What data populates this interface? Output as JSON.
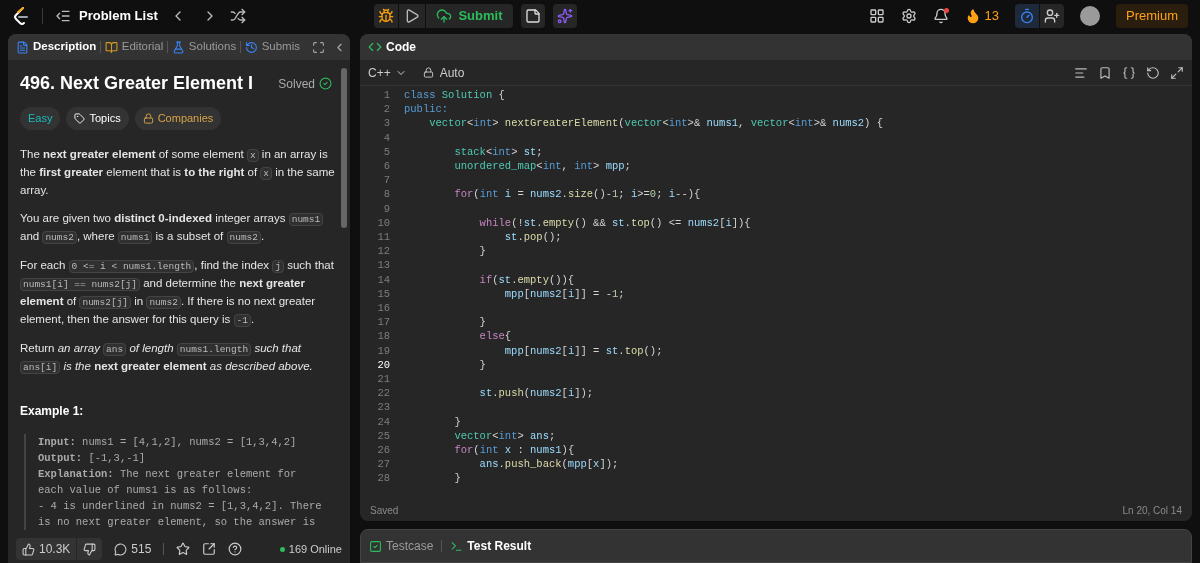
{
  "top_bar": {
    "problem_list": "Problem List",
    "submit": "Submit",
    "streak": "13",
    "premium": "Premium"
  },
  "description_panel": {
    "tabs": [
      {
        "label": "Description",
        "selected": true
      },
      {
        "label": "Editorial",
        "selected": false
      },
      {
        "label": "Solutions",
        "selected": false
      },
      {
        "label": "Submis",
        "selected": false
      }
    ],
    "title": "496. Next Greater Element I",
    "status": "Solved",
    "tags": [
      {
        "label": "Easy",
        "kind": "difficulty"
      },
      {
        "label": "Topics",
        "kind": "topics"
      },
      {
        "label": "Companies",
        "kind": "companies"
      }
    ],
    "paragraphs": [
      [
        {
          "kind": "text",
          "text": "The **next greater element** of some element "
        },
        {
          "kind": "code",
          "text": "x"
        },
        {
          "kind": "text",
          "text": " in an array is the **first greater** element that is **to the right** of "
        },
        {
          "kind": "code",
          "text": "x"
        },
        {
          "kind": "text",
          "text": " in the same array."
        }
      ],
      [
        {
          "kind": "text",
          "text": "You are given two **distinct 0-indexed** integer arrays "
        },
        {
          "kind": "code",
          "text": "nums1"
        },
        {
          "kind": "text",
          "text": " and "
        },
        {
          "kind": "code",
          "text": "nums2"
        },
        {
          "kind": "text",
          "text": ", where "
        },
        {
          "kind": "code",
          "text": "nums1"
        },
        {
          "kind": "text",
          "text": " is a subset of "
        },
        {
          "kind": "code",
          "text": "nums2"
        },
        {
          "kind": "text",
          "text": "."
        }
      ],
      [
        {
          "kind": "text",
          "text": "For each "
        },
        {
          "kind": "code",
          "text": "0 <= i < nums1.length"
        },
        {
          "kind": "text",
          "text": ", find the index "
        },
        {
          "kind": "code",
          "text": "j"
        },
        {
          "kind": "text",
          "text": " such that "
        },
        {
          "kind": "code",
          "text": "nums1[i] == nums2[j]"
        },
        {
          "kind": "text",
          "text": " and determine the **next greater element** of "
        },
        {
          "kind": "code",
          "text": "nums2[j]"
        },
        {
          "kind": "text",
          "text": " in "
        },
        {
          "kind": "code",
          "text": "nums2"
        },
        {
          "kind": "text",
          "text": ". If there is no next greater element, then the answer for this query is "
        },
        {
          "kind": "code",
          "text": "-1"
        },
        {
          "kind": "text",
          "text": "."
        }
      ],
      [
        {
          "kind": "text",
          "text": "Return *an array* "
        },
        {
          "kind": "code",
          "text": "ans"
        },
        {
          "kind": "text",
          "text": " *of length* "
        },
        {
          "kind": "code",
          "text": "nums1.length"
        },
        {
          "kind": "text",
          "text": " *such that* "
        },
        {
          "kind": "code",
          "text": "ans[i]"
        },
        {
          "kind": "text",
          "text": " *is the* **next greater element** *as described above.*"
        }
      ]
    ],
    "example_title": "Example 1:",
    "example_lines": [
      "**Input:** nums1 = [4,1,2], nums2 = [1,3,4,2]",
      "**Output:** [-1,3,-1]",
      "**Explanation:** The next greater element for",
      "each value of nums1 is as follows:",
      "- 4 is underlined in nums2 = [1,3,4,2]. There",
      "is no next greater element, so the answer is"
    ],
    "likes": "10.3K",
    "comments": "515",
    "online": "169 Online"
  },
  "code_panel": {
    "title": "Code",
    "language": "C++",
    "mode": "Auto",
    "status": "Saved",
    "cursor": "Ln 20, Col 14",
    "lines": [
      {
        "n": "1",
        "active": false,
        "tokens": [
          {
            "kind": "k",
            "text": "class "
          },
          {
            "kind": "t",
            "text": "Solution "
          },
          {
            "kind": "p",
            "text": "{"
          }
        ]
      },
      {
        "n": "2",
        "active": false,
        "tokens": [
          {
            "kind": "k",
            "text": "public:"
          }
        ]
      },
      {
        "n": "3",
        "active": false,
        "tokens": [
          {
            "kind": "t",
            "text": "    vector"
          },
          {
            "kind": "p",
            "text": "<"
          },
          {
            "kind": "k",
            "text": "int"
          },
          {
            "kind": "p",
            "text": "> "
          },
          {
            "kind": "f",
            "text": "nextGreaterElement"
          },
          {
            "kind": "p",
            "text": "("
          },
          {
            "kind": "t",
            "text": "vector"
          },
          {
            "kind": "p",
            "text": "<"
          },
          {
            "kind": "k",
            "text": "int"
          },
          {
            "kind": "p",
            "text": ">& "
          },
          {
            "kind": "v",
            "text": "nums1"
          },
          {
            "kind": "p",
            "text": ", "
          },
          {
            "kind": "t",
            "text": "vector"
          },
          {
            "kind": "p",
            "text": "<"
          },
          {
            "kind": "k",
            "text": "int"
          },
          {
            "kind": "p",
            "text": ">& "
          },
          {
            "kind": "v",
            "text": "nums2"
          },
          {
            "kind": "p",
            "text": ") {"
          }
        ]
      },
      {
        "n": "4",
        "active": false
      },
      {
        "n": "5",
        "active": false,
        "tokens": [
          {
            "kind": "t",
            "text": "        stack"
          },
          {
            "kind": "p",
            "text": "<"
          },
          {
            "kind": "k",
            "text": "int"
          },
          {
            "kind": "p",
            "text": "> "
          },
          {
            "kind": "v",
            "text": "st"
          },
          {
            "kind": "p",
            "text": ";"
          }
        ]
      },
      {
        "n": "6",
        "active": false,
        "tokens": [
          {
            "kind": "t",
            "text": "        unordered_map"
          },
          {
            "kind": "p",
            "text": "<"
          },
          {
            "kind": "k",
            "text": "int"
          },
          {
            "kind": "p",
            "text": ", "
          },
          {
            "kind": "k",
            "text": "int"
          },
          {
            "kind": "p",
            "text": "> "
          },
          {
            "kind": "v",
            "text": "mpp"
          },
          {
            "kind": "p",
            "text": ";"
          }
        ]
      },
      {
        "n": "7",
        "active": false
      },
      {
        "n": "8",
        "active": false,
        "tokens": [
          {
            "kind": "c",
            "text": "        for"
          },
          {
            "kind": "p",
            "text": "("
          },
          {
            "kind": "k",
            "text": "int "
          },
          {
            "kind": "v",
            "text": "i"
          },
          {
            "kind": "p",
            "text": " = "
          },
          {
            "kind": "v",
            "text": "nums2"
          },
          {
            "kind": "p",
            "text": "."
          },
          {
            "kind": "f",
            "text": "size"
          },
          {
            "kind": "p",
            "text": "()-"
          },
          {
            "kind": "n",
            "text": "1"
          },
          {
            "kind": "p",
            "text": "; "
          },
          {
            "kind": "v",
            "text": "i"
          },
          {
            "kind": "p",
            "text": ">="
          },
          {
            "kind": "n",
            "text": "0"
          },
          {
            "kind": "p",
            "text": "; "
          },
          {
            "kind": "v",
            "text": "i"
          },
          {
            "kind": "p",
            "text": "--){"
          }
        ]
      },
      {
        "n": "9",
        "active": false
      },
      {
        "n": "10",
        "active": false,
        "tokens": [
          {
            "kind": "c",
            "text": "            while"
          },
          {
            "kind": "p",
            "text": "(!"
          },
          {
            "kind": "v",
            "text": "st"
          },
          {
            "kind": "p",
            "text": "."
          },
          {
            "kind": "f",
            "text": "empty"
          },
          {
            "kind": "p",
            "text": "() && "
          },
          {
            "kind": "v",
            "text": "st"
          },
          {
            "kind": "p",
            "text": "."
          },
          {
            "kind": "f",
            "text": "top"
          },
          {
            "kind": "p",
            "text": "() <= "
          },
          {
            "kind": "v",
            "text": "nums2"
          },
          {
            "kind": "p",
            "text": "["
          },
          {
            "kind": "v",
            "text": "i"
          },
          {
            "kind": "p",
            "text": "]){"
          }
        ]
      },
      {
        "n": "11",
        "active": false,
        "tokens": [
          {
            "kind": "v",
            "text": "                st"
          },
          {
            "kind": "p",
            "text": "."
          },
          {
            "kind": "f",
            "text": "pop"
          },
          {
            "kind": "p",
            "text": "();"
          }
        ]
      },
      {
        "n": "12",
        "active": false,
        "tokens": [
          {
            "kind": "p",
            "text": "            }"
          }
        ]
      },
      {
        "n": "13",
        "active": false
      },
      {
        "n": "14",
        "active": false,
        "tokens": [
          {
            "kind": "c",
            "text": "            if"
          },
          {
            "kind": "p",
            "text": "("
          },
          {
            "kind": "v",
            "text": "st"
          },
          {
            "kind": "p",
            "text": "."
          },
          {
            "kind": "f",
            "text": "empty"
          },
          {
            "kind": "p",
            "text": "()){"
          }
        ]
      },
      {
        "n": "15",
        "active": false,
        "tokens": [
          {
            "kind": "v",
            "text": "                mpp"
          },
          {
            "kind": "p",
            "text": "["
          },
          {
            "kind": "v",
            "text": "nums2"
          },
          {
            "kind": "p",
            "text": "["
          },
          {
            "kind": "v",
            "text": "i"
          },
          {
            "kind": "p",
            "text": "]] = -"
          },
          {
            "kind": "n",
            "text": "1"
          },
          {
            "kind": "p",
            "text": ";"
          }
        ]
      },
      {
        "n": "16",
        "active": false
      },
      {
        "n": "17",
        "active": false,
        "tokens": [
          {
            "kind": "p",
            "text": "            }"
          }
        ]
      },
      {
        "n": "18",
        "active": false,
        "tokens": [
          {
            "kind": "c",
            "text": "            else"
          },
          {
            "kind": "p",
            "text": "{"
          }
        ]
      },
      {
        "n": "19",
        "active": false,
        "tokens": [
          {
            "kind": "v",
            "text": "                mpp"
          },
          {
            "kind": "p",
            "text": "["
          },
          {
            "kind": "v",
            "text": "nums2"
          },
          {
            "kind": "p",
            "text": "["
          },
          {
            "kind": "v",
            "text": "i"
          },
          {
            "kind": "p",
            "text": "]] = "
          },
          {
            "kind": "v",
            "text": "st"
          },
          {
            "kind": "p",
            "text": "."
          },
          {
            "kind": "f",
            "text": "top"
          },
          {
            "kind": "p",
            "text": "();"
          }
        ]
      },
      {
        "n": "20",
        "active": true,
        "tokens": [
          {
            "kind": "p",
            "text": "            }"
          }
        ]
      },
      {
        "n": "21",
        "active": false
      },
      {
        "n": "22",
        "active": false,
        "tokens": [
          {
            "kind": "v",
            "text": "            st"
          },
          {
            "kind": "p",
            "text": "."
          },
          {
            "kind": "f",
            "text": "push"
          },
          {
            "kind": "p",
            "text": "("
          },
          {
            "kind": "v",
            "text": "nums2"
          },
          {
            "kind": "p",
            "text": "["
          },
          {
            "kind": "v",
            "text": "i"
          },
          {
            "kind": "p",
            "text": "]);"
          }
        ]
      },
      {
        "n": "23",
        "active": false
      },
      {
        "n": "24",
        "active": false,
        "tokens": [
          {
            "kind": "p",
            "text": "        }"
          }
        ]
      },
      {
        "n": "25",
        "active": false,
        "tokens": [
          {
            "kind": "t",
            "text": "        vector"
          },
          {
            "kind": "p",
            "text": "<"
          },
          {
            "kind": "k",
            "text": "int"
          },
          {
            "kind": "p",
            "text": "> "
          },
          {
            "kind": "v",
            "text": "ans"
          },
          {
            "kind": "p",
            "text": ";"
          }
        ]
      },
      {
        "n": "26",
        "active": false,
        "tokens": [
          {
            "kind": "c",
            "text": "        for"
          },
          {
            "kind": "p",
            "text": "("
          },
          {
            "kind": "k",
            "text": "int "
          },
          {
            "kind": "v",
            "text": "x"
          },
          {
            "kind": "p",
            "text": " : "
          },
          {
            "kind": "v",
            "text": "nums1"
          },
          {
            "kind": "p",
            "text": "){"
          }
        ]
      },
      {
        "n": "27",
        "active": false,
        "tokens": [
          {
            "kind": "v",
            "text": "            ans"
          },
          {
            "kind": "p",
            "text": "."
          },
          {
            "kind": "f",
            "text": "push_back"
          },
          {
            "kind": "p",
            "text": "("
          },
          {
            "kind": "v",
            "text": "mpp"
          },
          {
            "kind": "p",
            "text": "["
          },
          {
            "kind": "v",
            "text": "x"
          },
          {
            "kind": "p",
            "text": "]);"
          }
        ]
      },
      {
        "n": "28",
        "active": false,
        "tokens": [
          {
            "kind": "p",
            "text": "        }"
          }
        ]
      }
    ]
  },
  "result_panel": {
    "tabs": [
      {
        "label": "Testcase",
        "selected": false
      },
      {
        "label": "Test Result",
        "selected": true
      }
    ]
  }
}
